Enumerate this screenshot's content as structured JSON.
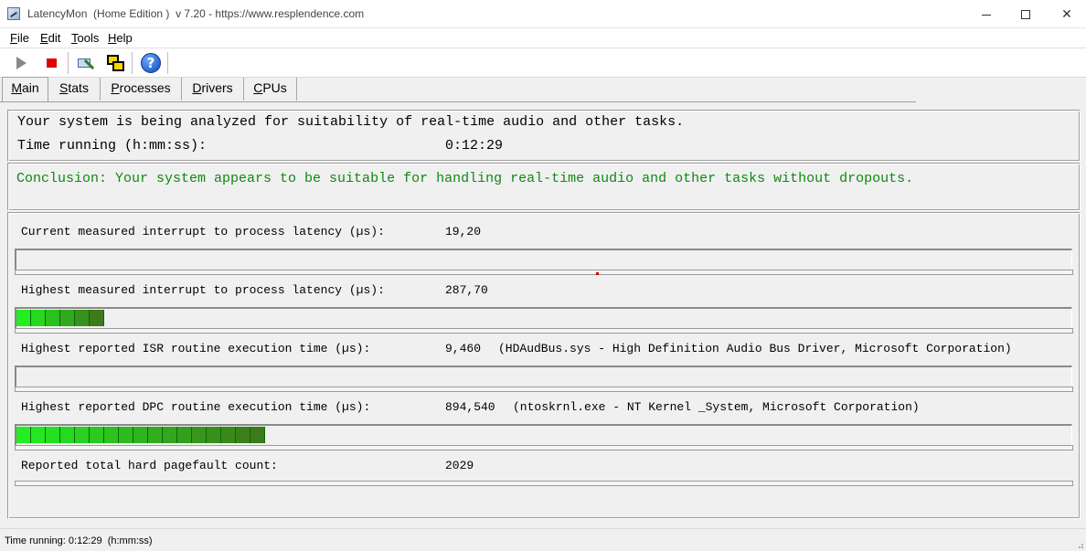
{
  "window": {
    "title": "LatencyMon  (Home Edition )  v 7.20 - https://www.resplendence.com"
  },
  "menu": [
    {
      "key": "F",
      "rest": "ile"
    },
    {
      "key": "E",
      "rest": "dit"
    },
    {
      "key": "T",
      "rest": "ools"
    },
    {
      "key": "H",
      "rest": "elp"
    }
  ],
  "toolbar": {
    "icons": [
      "play-icon",
      "stop-icon",
      "hardware-icon",
      "windows-icon",
      "help-icon"
    ],
    "help_glyph": "?"
  },
  "tabs": [
    {
      "key": "M",
      "rest": "ain",
      "active": true
    },
    {
      "key": "S",
      "rest": "tats",
      "active": false
    },
    {
      "key": "P",
      "rest": "rocesses",
      "active": false
    },
    {
      "key": "D",
      "rest": "rivers",
      "active": false
    },
    {
      "key": "C",
      "rest": "PUs",
      "active": false
    }
  ],
  "analysis": {
    "status_line": "Your system is being analyzed for suitability of real-time audio and other tasks.",
    "time_label": "Time running (h:mm:ss):",
    "time_value": "0:12:29",
    "conclusion": "Conclusion: Your system appears to be suitable for handling real-time audio and other tasks without dropouts.",
    "conclusion_color": "#118811"
  },
  "metrics": [
    {
      "label": "Current measured interrupt to process latency (µs):",
      "value": "19,20",
      "detail": "",
      "bar_segments": 0
    },
    {
      "label": "Highest measured interrupt to process latency (µs):",
      "value": "287,70",
      "detail": "",
      "bar_segments": 6
    },
    {
      "label": "Highest reported ISR routine execution time (µs):",
      "value": "9,460",
      "detail": "(HDAudBus.sys - High Definition Audio Bus Driver, Microsoft Corporation)",
      "bar_segments": 0
    },
    {
      "label": "Highest reported DPC routine execution time (µs):",
      "value": "894,540",
      "detail": "(ntoskrnl.exe - NT Kernel _System, Microsoft Corporation)",
      "bar_segments": 17
    },
    {
      "label": "Reported total hard pagefault count:",
      "value": "2029",
      "detail": "",
      "bar_segments": null
    }
  ],
  "status_bar": {
    "text": "Time running: 0:12:29  (h:mm:ss)"
  },
  "colors": {
    "bar_green_light": "#22ee22",
    "bar_green_dark": "#3c7a1a",
    "stop_red": "#e00000"
  }
}
